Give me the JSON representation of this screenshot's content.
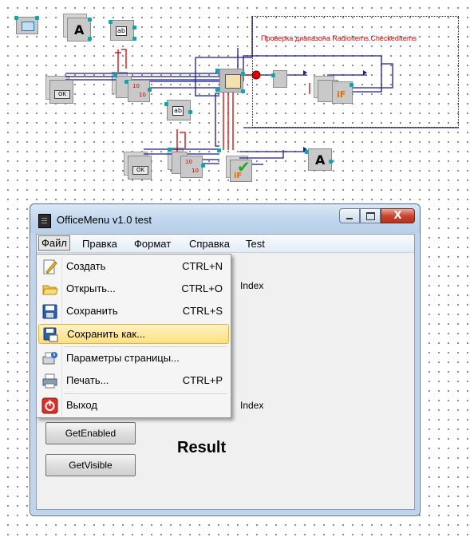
{
  "diagram": {
    "annotation": "Проверка диапазона RadioItems.CheckedItems",
    "label_A": "A",
    "label_ab": "ab",
    "ok": "OK",
    "num_10": "10",
    "if_label": "iF"
  },
  "window": {
    "title": "OfficeMenu v1.0 test",
    "close_glyph": "X"
  },
  "menubar": {
    "items": [
      "Файл",
      "Правка",
      "Формат",
      "Справка",
      "Test"
    ]
  },
  "file_menu": {
    "items": [
      {
        "label": "Создать",
        "shortcut": "CTRL+N",
        "icon": "new-document-icon"
      },
      {
        "label": "Открыть...",
        "shortcut": "CTRL+O",
        "icon": "open-folder-icon"
      },
      {
        "label": "Сохранить",
        "shortcut": "CTRL+S",
        "icon": "save-disk-icon"
      },
      {
        "label": "Сохранить как...",
        "shortcut": "",
        "icon": "save-as-icon",
        "highlighted": true
      },
      {
        "label": "Параметры страницы...",
        "shortcut": "",
        "icon": "page-setup-icon"
      },
      {
        "label": "Печать...",
        "shortcut": "CTRL+P",
        "icon": "printer-icon"
      },
      {
        "label": "Выход",
        "shortcut": "",
        "icon": "power-icon"
      }
    ]
  },
  "client": {
    "index_label_1": "Index",
    "index_label_2": "Index",
    "get_enabled": "GetEnabled",
    "get_visible": "GetVisible",
    "result": "Result"
  },
  "colors": {
    "wire_blue": "#1a1a8c",
    "wire_red": "#d00000",
    "pin_teal": "#19a3a8",
    "highlight": "#ffdf7e"
  }
}
